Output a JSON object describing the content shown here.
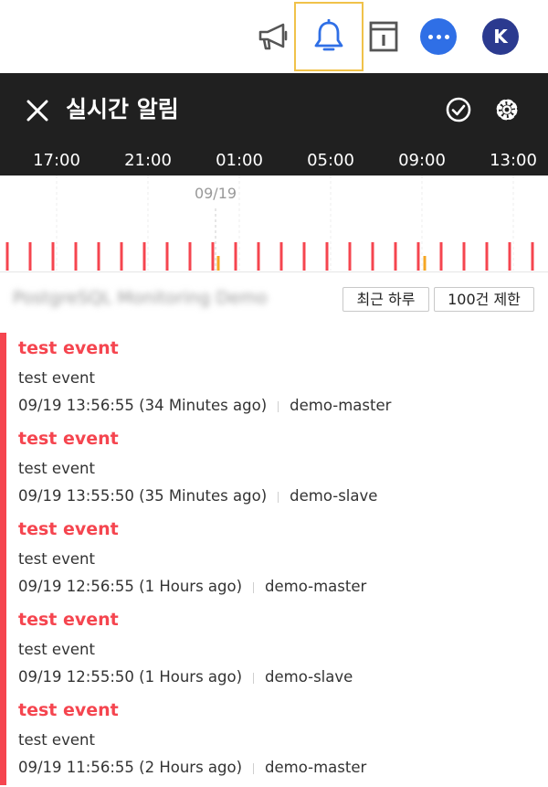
{
  "toolbar": {
    "icons": [
      "megaphone-icon",
      "bell-icon",
      "info-panel-icon",
      "chat-icon",
      "avatar"
    ],
    "active": "bell-icon",
    "avatar_initial": "K",
    "colors": {
      "active_border": "#f0c24a",
      "bell": "#2f6fe6",
      "chat": "#2f6fe6",
      "avatar": "#2b3a8f",
      "icon_gray": "#555555"
    }
  },
  "header": {
    "title": "실시간 알림"
  },
  "timeline": {
    "axis_labels": [
      "17:00",
      "21:00",
      "01:00",
      "05:00",
      "09:00",
      "13:00"
    ],
    "date_marker": "09/19",
    "colors": {
      "critical": "#f5454f",
      "warning": "#f5a623"
    }
  },
  "filter": {
    "project_name": "PostgreSQL Monitoring Demo",
    "range_label": "최근 하루",
    "limit_label": "100건 제한"
  },
  "events": [
    {
      "title": "test event",
      "message": "test event",
      "time": "09/19 13:56:55 (34 Minutes ago)",
      "agent": "demo-master"
    },
    {
      "title": "test event",
      "message": "test event",
      "time": "09/19 13:55:50 (35 Minutes ago)",
      "agent": "demo-slave"
    },
    {
      "title": "test event",
      "message": "test event",
      "time": "09/19 12:56:55 (1 Hours ago)",
      "agent": "demo-master"
    },
    {
      "title": "test event",
      "message": "test event",
      "time": "09/19 12:55:50 (1 Hours ago)",
      "agent": "demo-slave"
    },
    {
      "title": "test event",
      "message": "test event",
      "time": "09/19 11:56:55 (2 Hours ago)",
      "agent": "demo-master"
    }
  ]
}
